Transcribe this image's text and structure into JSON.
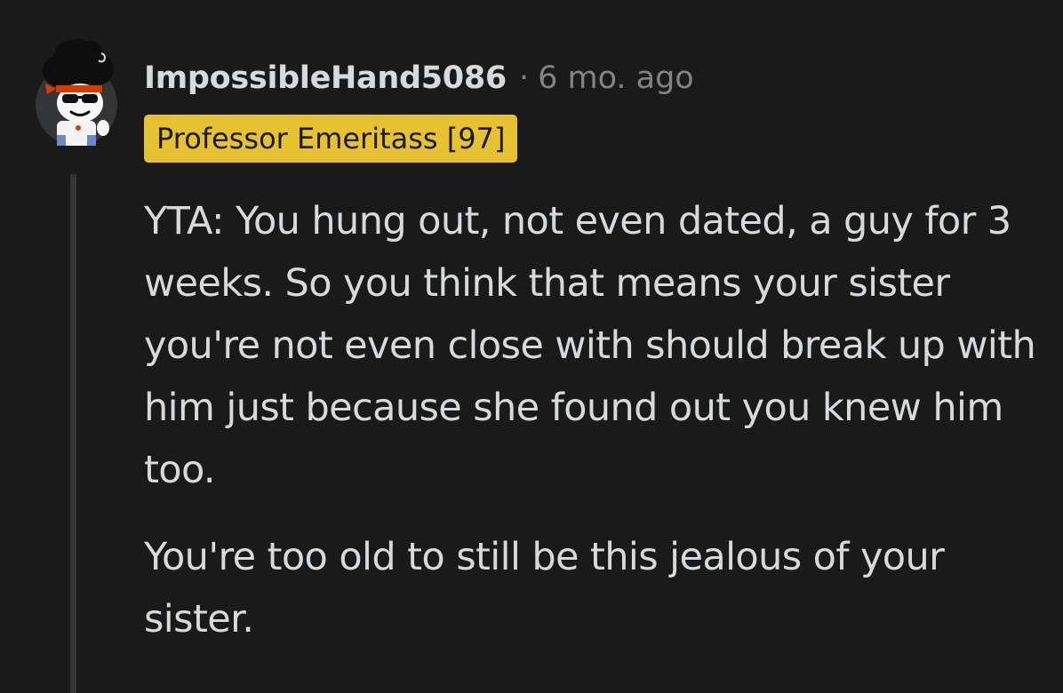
{
  "comment": {
    "author": "ImpossibleHand5086",
    "separator": "·",
    "timestamp": "6 mo. ago",
    "flair": "Professor Emeritass [97]",
    "avatar_icon": "snoo-avatar-icon",
    "paragraphs": [
      "YTA: You hung out, not even dated, a guy for 3 weeks. So you think that means your sister you're not even close with should break up with him just because she found out you knew him too.",
      "You're too old to still be this jealous of your sister."
    ]
  },
  "colors": {
    "background": "#1a1a1b",
    "text": "#d7dadc",
    "meta": "#818384",
    "flair_bg": "#e6c233",
    "flair_text": "#1a1a1b",
    "thread_line": "#343536"
  }
}
